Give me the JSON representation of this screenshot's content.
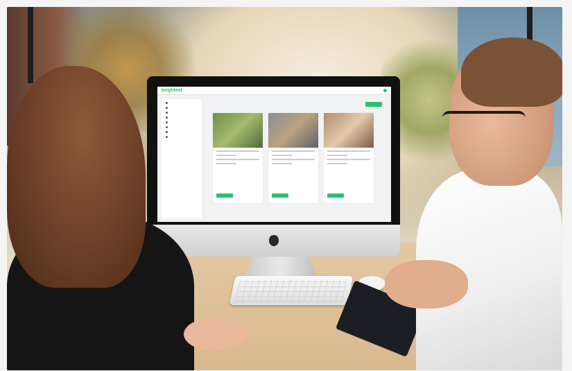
{
  "scene": {
    "description_elements": [
      "office",
      "monitor",
      "keyboard",
      "mouse",
      "notebook",
      "two-people"
    ]
  },
  "screen_app": {
    "logo": "brightest",
    "accent_color": "#27c46b"
  },
  "icons": {
    "apple": "apple-logo-icon"
  }
}
